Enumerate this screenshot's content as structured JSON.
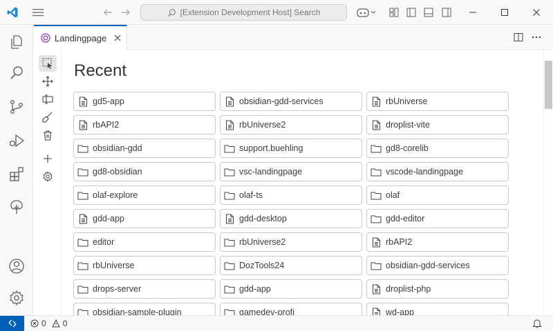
{
  "titlebar": {
    "search_text": "[Extension Development Host] Search"
  },
  "activitybar": {
    "items": [
      "explorer-icon",
      "search-icon",
      "source-control-icon",
      "run-debug-icon",
      "extensions-icon",
      "tree-icon"
    ],
    "bottom": [
      "accounts-icon",
      "manage-gear-icon"
    ]
  },
  "tabs": [
    {
      "label": "Landingpage",
      "active": true
    }
  ],
  "main": {
    "heading": "Recent",
    "items": [
      {
        "label": "gd5-app",
        "icon": "file"
      },
      {
        "label": "obsidian-gdd-services",
        "icon": "file"
      },
      {
        "label": "rbUniverse",
        "icon": "file"
      },
      {
        "label": "rbAPI2",
        "icon": "file"
      },
      {
        "label": "rbUniverse2",
        "icon": "file"
      },
      {
        "label": "droplist-vite",
        "icon": "file"
      },
      {
        "label": "obsidian-gdd",
        "icon": "folder"
      },
      {
        "label": "support.buehling",
        "icon": "folder"
      },
      {
        "label": "gd8-corelib",
        "icon": "folder"
      },
      {
        "label": "gd8-obsidian",
        "icon": "folder"
      },
      {
        "label": "vsc-landingpage",
        "icon": "folder"
      },
      {
        "label": "vscode-landingpage",
        "icon": "folder"
      },
      {
        "label": "olaf-explore",
        "icon": "folder"
      },
      {
        "label": "olaf-ts",
        "icon": "folder"
      },
      {
        "label": "olaf",
        "icon": "folder"
      },
      {
        "label": "gdd-app",
        "icon": "file"
      },
      {
        "label": "gdd-desktop",
        "icon": "file"
      },
      {
        "label": "gdd-editor",
        "icon": "folder"
      },
      {
        "label": "editor",
        "icon": "folder"
      },
      {
        "label": "rbUniverse2",
        "icon": "folder"
      },
      {
        "label": "rbAPI2",
        "icon": "file"
      },
      {
        "label": "rbUniverse",
        "icon": "folder"
      },
      {
        "label": "DozTools24",
        "icon": "folder"
      },
      {
        "label": "obsidian-gdd-services",
        "icon": "folder"
      },
      {
        "label": "drops-server",
        "icon": "folder"
      },
      {
        "label": "gdd-app",
        "icon": "folder"
      },
      {
        "label": "droplist-php",
        "icon": "file"
      },
      {
        "label": "obsidian-sample-plugin",
        "icon": "folder"
      },
      {
        "label": "gamedev-profi",
        "icon": "folder"
      },
      {
        "label": "wd-app",
        "icon": "file"
      }
    ]
  },
  "statusbar": {
    "errors": "0",
    "warnings": "0"
  },
  "colors": {
    "accent": "#005fb8",
    "tab_icon": "#8a3ec9"
  }
}
